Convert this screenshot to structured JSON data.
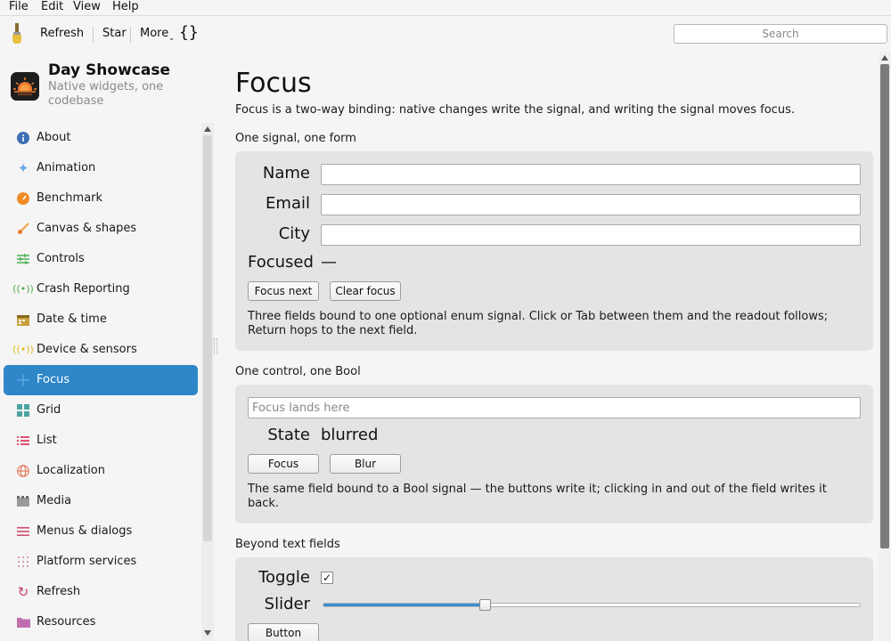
{
  "menubar": [
    "File",
    "Edit",
    "View",
    "Help"
  ],
  "toolbar": {
    "refresh_label": "Refresh",
    "star_label": "Star",
    "more_label": "More",
    "braces_label": "{}",
    "search_placeholder": "Search"
  },
  "app": {
    "title": "Day Showcase",
    "subtitle": "Native widgets, one codebase"
  },
  "sidebar": {
    "items": [
      {
        "label": "About",
        "icon": "info-icon",
        "color": "#3c6fb4"
      },
      {
        "label": "Animation",
        "icon": "sparkle-icon",
        "color": "#6aa9e6"
      },
      {
        "label": "Benchmark",
        "icon": "gauge-icon",
        "color": "#f08a24"
      },
      {
        "label": "Canvas & shapes",
        "icon": "brush-icon",
        "color": "#f0a040"
      },
      {
        "label": "Controls",
        "icon": "sliders-icon",
        "color": "#4caf50"
      },
      {
        "label": "Crash Reporting",
        "icon": "broadcast-icon",
        "color": "#4caf50"
      },
      {
        "label": "Date & time",
        "icon": "calendar-icon",
        "color": "#c8a040"
      },
      {
        "label": "Device & sensors",
        "icon": "sensor-icon",
        "color": "#e6b820"
      },
      {
        "label": "Focus",
        "icon": "crosshair-icon",
        "color": "#2f87c9"
      },
      {
        "label": "Grid",
        "icon": "grid-icon",
        "color": "#4aa3a0"
      },
      {
        "label": "List",
        "icon": "list-icon",
        "color": "#e05070"
      },
      {
        "label": "Localization",
        "icon": "globe-icon",
        "color": "#e07a5a"
      },
      {
        "label": "Media",
        "icon": "film-icon",
        "color": "#8a8a8a"
      },
      {
        "label": "Menus & dialogs",
        "icon": "menu-icon",
        "color": "#d05070"
      },
      {
        "label": "Platform services",
        "icon": "dots-grid-icon",
        "color": "#d080a0"
      },
      {
        "label": "Refresh",
        "icon": "refresh-icon",
        "color": "#c04060"
      },
      {
        "label": "Resources",
        "icon": "folder-icon",
        "color": "#c070b0"
      }
    ],
    "active_index": 8
  },
  "main": {
    "title": "Focus",
    "description": "Focus is a two-way binding: native changes write the signal, and writing the signal moves focus.",
    "section1": {
      "title": "One signal, one form",
      "name_label": "Name",
      "email_label": "Email",
      "city_label": "City",
      "name_value": "",
      "email_value": "",
      "city_value": "",
      "focused_label": "Focused",
      "focused_value": "—",
      "focus_next_label": "Focus next",
      "clear_focus_label": "Clear focus",
      "note": "Three fields bound to one optional enum signal. Click or Tab between them and the readout follows; Return hops to the next field."
    },
    "section2": {
      "title": "One control, one Bool",
      "placeholder": "Focus lands here",
      "state_label": "State",
      "state_value": "blurred",
      "focus_label": "Focus",
      "blur_label": "Blur",
      "note": "The same field bound to a Bool signal — the buttons write it; clicking in and out of the field writes it back."
    },
    "section3": {
      "title": "Beyond text fields",
      "toggle_label": "Toggle",
      "toggle_checked": "✓",
      "slider_label": "Slider",
      "slider_value_fraction": 0.3,
      "button_label": "Button"
    }
  }
}
